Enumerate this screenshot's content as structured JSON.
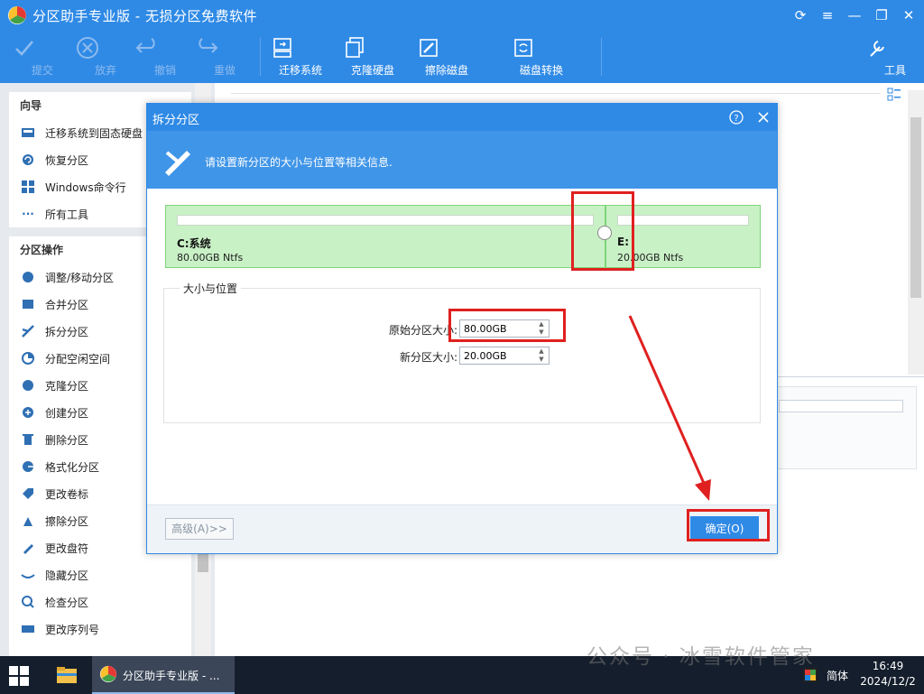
{
  "window": {
    "title": "分区助手专业版 - 无损分区免费软件"
  },
  "toolbar": {
    "items": [
      {
        "label": "提交",
        "icon": "check-icon",
        "enabled": false
      },
      {
        "label": "放弃",
        "icon": "cancel-circle-icon",
        "enabled": false
      },
      {
        "label": "撤销",
        "icon": "undo-icon",
        "enabled": false
      },
      {
        "label": "重做",
        "icon": "redo-icon",
        "enabled": false
      },
      {
        "label": "迁移系统",
        "icon": "migrate-os-icon",
        "enabled": true
      },
      {
        "label": "克隆硬盘",
        "icon": "clone-disk-icon",
        "enabled": true
      },
      {
        "label": "擦除磁盘",
        "icon": "wipe-disk-icon",
        "enabled": true
      },
      {
        "label": "磁盘转换",
        "icon": "convert-disk-icon",
        "enabled": true
      },
      {
        "label": "工具",
        "icon": "tools-icon",
        "enabled": true
      }
    ]
  },
  "sidebar": {
    "guide": {
      "title": "向导",
      "items": [
        {
          "label": "迁移系统到固态硬盘",
          "icon": "migrate-ssd-icon"
        },
        {
          "label": "恢复分区",
          "icon": "recover-partition-icon"
        },
        {
          "label": "Windows命令行",
          "icon": "windows-icon"
        },
        {
          "label": "所有工具",
          "icon": "more-icon"
        }
      ]
    },
    "operations": {
      "title": "分区操作",
      "items": [
        {
          "label": "调整/移动分区",
          "icon": "resize-icon"
        },
        {
          "label": "合并分区",
          "icon": "merge-icon"
        },
        {
          "label": "拆分分区",
          "icon": "split-icon"
        },
        {
          "label": "分配空闲空间",
          "icon": "allocate-icon"
        },
        {
          "label": "克隆分区",
          "icon": "clone-partition-icon"
        },
        {
          "label": "创建分区",
          "icon": "create-partition-icon"
        },
        {
          "label": "删除分区",
          "icon": "delete-icon"
        },
        {
          "label": "格式化分区",
          "icon": "format-icon"
        },
        {
          "label": "更改卷标",
          "icon": "label-icon"
        },
        {
          "label": "擦除分区",
          "icon": "wipe-partition-icon"
        },
        {
          "label": "更改盘符",
          "icon": "drive-letter-icon"
        },
        {
          "label": "隐藏分区",
          "icon": "hide-icon"
        },
        {
          "label": "检查分区",
          "icon": "check-partition-icon"
        },
        {
          "label": "更改序列号",
          "icon": "serial-number-icon"
        }
      ]
    }
  },
  "dialog": {
    "title": "拆分分区",
    "banner_text": "请设置新分区的大小与位置等相关信息.",
    "partitions": [
      {
        "name": "C:系统",
        "info": "80.00GB Ntfs"
      },
      {
        "name": "E:",
        "info": "20.00GB Ntfs"
      }
    ],
    "group_title": "大小与位置",
    "original_size_label": "原始分区大小:",
    "original_size_value": "80.00GB",
    "new_size_label": "新分区大小:",
    "new_size_value": "20.00GB",
    "advanced_button": "高级(A)>>",
    "ok_button": "确定(O)"
  },
  "taskbar": {
    "app_label": "分区助手专业版 - ...",
    "input_language": "简体",
    "time": "16:49",
    "date": "2024/12/2"
  },
  "watermark": "公众号 · 冰雪软件管家",
  "colors": {
    "titlebar": "#2f8ae6",
    "partition_fill": "#c9f1c6",
    "annotation_red": "#e02020"
  }
}
